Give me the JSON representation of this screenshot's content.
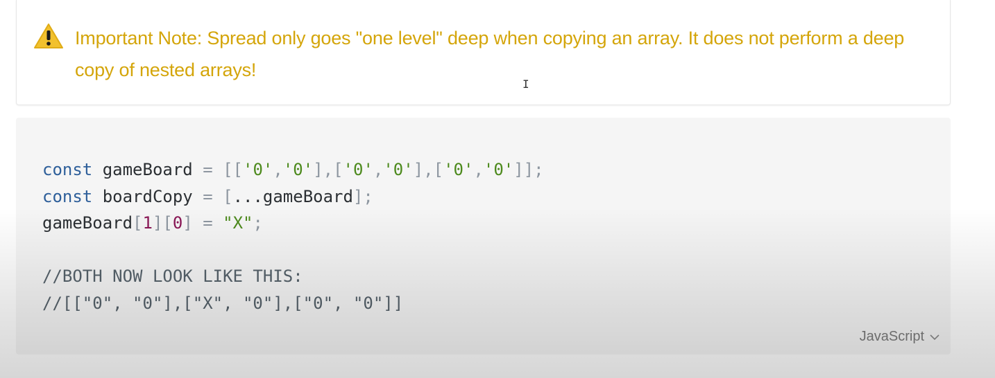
{
  "note": {
    "icon": "warning-icon",
    "text": "Important Note: Spread only goes \"one level\" deep when copying an array.  It does not perform a deep copy of nested arrays!",
    "color": "#d4a50a"
  },
  "cursor": {
    "glyph": "I"
  },
  "code": {
    "language": "JavaScript",
    "lines": [
      [
        {
          "t": "const",
          "c": "kw"
        },
        {
          "t": " gameBoard ",
          "c": "plain"
        },
        {
          "t": "=",
          "c": "punct"
        },
        {
          "t": " [[",
          "c": "punct"
        },
        {
          "t": "'0'",
          "c": "str"
        },
        {
          "t": ",",
          "c": "punct"
        },
        {
          "t": "'0'",
          "c": "str"
        },
        {
          "t": "],[",
          "c": "punct"
        },
        {
          "t": "'0'",
          "c": "str"
        },
        {
          "t": ",",
          "c": "punct"
        },
        {
          "t": "'0'",
          "c": "str"
        },
        {
          "t": "],[",
          "c": "punct"
        },
        {
          "t": "'0'",
          "c": "str"
        },
        {
          "t": ",",
          "c": "punct"
        },
        {
          "t": "'0'",
          "c": "str"
        },
        {
          "t": "]];",
          "c": "punct"
        }
      ],
      [
        {
          "t": "const",
          "c": "kw"
        },
        {
          "t": " boardCopy ",
          "c": "plain"
        },
        {
          "t": "=",
          "c": "punct"
        },
        {
          "t": " [",
          "c": "punct"
        },
        {
          "t": "...gameBoard",
          "c": "plain"
        },
        {
          "t": "];",
          "c": "punct"
        }
      ],
      [
        {
          "t": "gameBoard",
          "c": "plain"
        },
        {
          "t": "[",
          "c": "punct"
        },
        {
          "t": "1",
          "c": "num"
        },
        {
          "t": "][",
          "c": "punct"
        },
        {
          "t": "0",
          "c": "num"
        },
        {
          "t": "]",
          "c": "punct"
        },
        {
          "t": " = ",
          "c": "punct"
        },
        {
          "t": "\"X\"",
          "c": "str"
        },
        {
          "t": ";",
          "c": "punct"
        }
      ],
      [],
      [
        {
          "t": "//BOTH NOW LOOK LIKE THIS:",
          "c": "comment"
        }
      ],
      [
        {
          "t": "//[[\"0\", \"0\"],[\"X\", \"0\"],[\"0\", \"0\"]]",
          "c": "comment"
        }
      ]
    ]
  },
  "colors": {
    "keyword": "#2e5f9a",
    "string": "#4d8a1d",
    "number": "#8a1756",
    "punctuation": "#8d96a0",
    "comment": "#56626b",
    "code_background": "#f5f5f5"
  }
}
